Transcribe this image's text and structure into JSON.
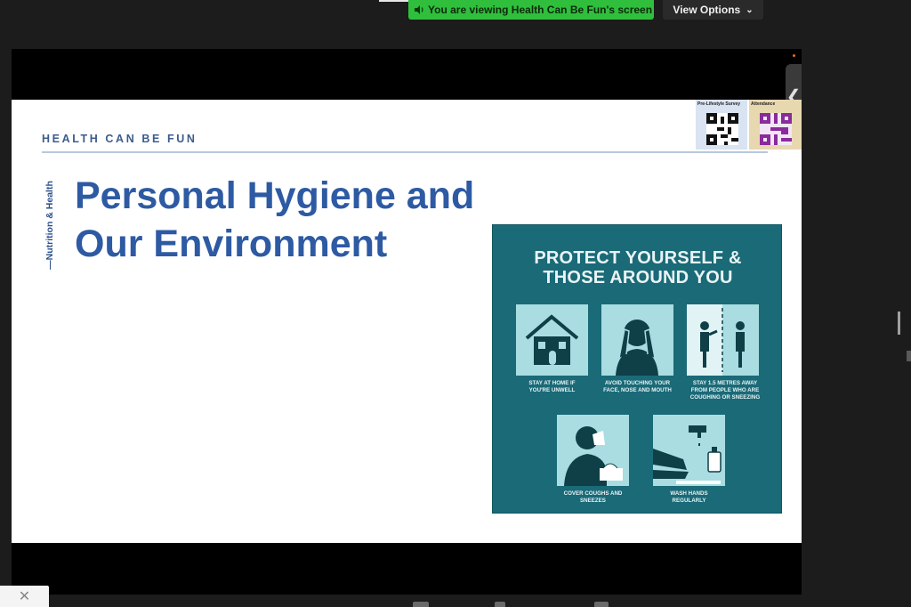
{
  "meeting": {
    "viewing_banner": "You are viewing Health Can Be Fun's screen",
    "view_options_label": "View Options",
    "collapse_glyph": "❮",
    "close_glyph": "✕"
  },
  "slide": {
    "brand": "HEALTH CAN BE FUN",
    "vertical_label": "—Nutrition & Health",
    "title_line1": "Personal Hygiene and",
    "title_line2": "Our Environment",
    "qr": [
      {
        "label": "Pre-Lifestyle Survey"
      },
      {
        "label": "Attendance"
      }
    ],
    "poster": {
      "title_line1": "PROTECT YOURSELF &",
      "title_line2": "THOSE AROUND YOU",
      "tips": [
        {
          "line1": "STAY AT HOME IF",
          "line2": "YOU'RE UNWELL",
          "line3": ""
        },
        {
          "line1": "AVOID TOUCHING YOUR",
          "line2": "FACE, NOSE AND MOUTH",
          "line3": ""
        },
        {
          "line1": "STAY 1.5 METRES AWAY",
          "line2": "FROM PEOPLE WHO ARE",
          "line3": "COUGHING OR SNEEZING"
        },
        {
          "line1": "COVER COUGHS AND",
          "line2": "SNEEZES",
          "line3": ""
        },
        {
          "line1": "WASH HANDS",
          "line2": "REGULARLY",
          "line3": ""
        }
      ]
    }
  },
  "colors": {
    "banner_green": "#2fbf3c",
    "title_blue": "#2d5aa3",
    "poster_teal": "#1a6a77",
    "tile_cyan": "#a9dde2"
  }
}
